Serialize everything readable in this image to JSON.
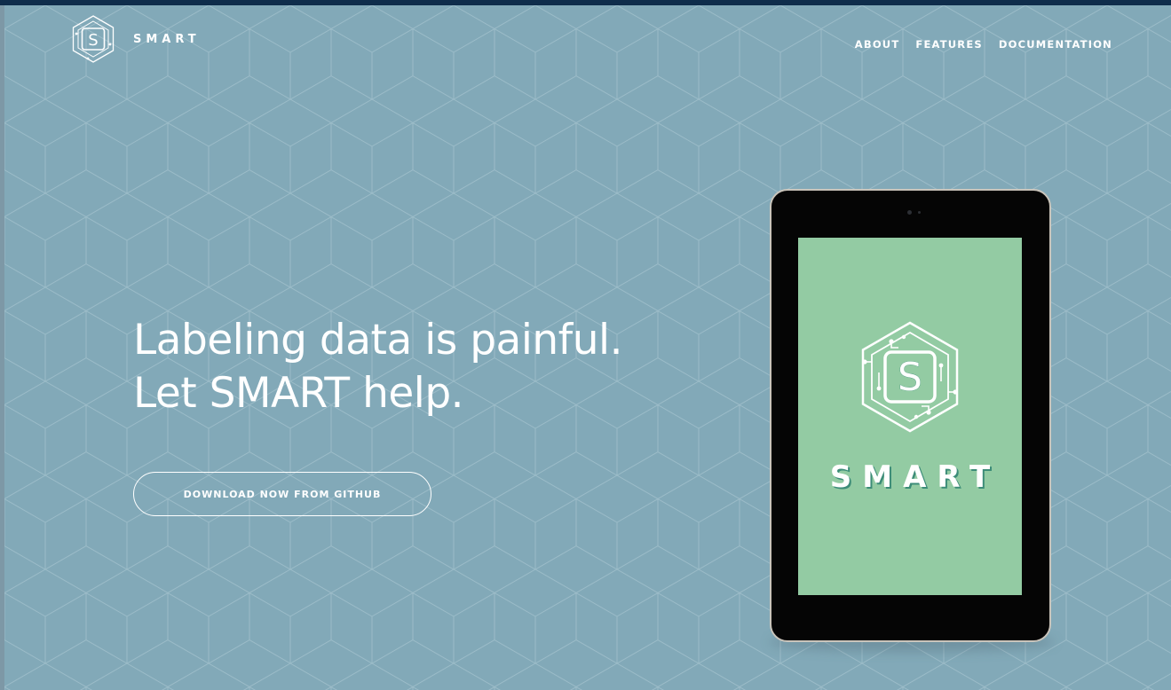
{
  "brand": {
    "name": "SMART",
    "logo_letter": "S"
  },
  "nav": {
    "items": [
      {
        "label": "ABOUT"
      },
      {
        "label": "FEATURES"
      },
      {
        "label": "DOCUMENTATION"
      }
    ]
  },
  "hero": {
    "line1": "Labeling data is painful.",
    "line2": "Let SMART help."
  },
  "cta": {
    "label": "DOWNLOAD NOW FROM GITHUB"
  },
  "tablet": {
    "screen_brand": "SMART",
    "logo_letter": "S"
  },
  "colors": {
    "background": "#82a9b8",
    "top_strip": "#0f2d4b",
    "tablet_screen": "#93cba3",
    "tablet_bezel": "#050505",
    "text": "#ffffff"
  }
}
